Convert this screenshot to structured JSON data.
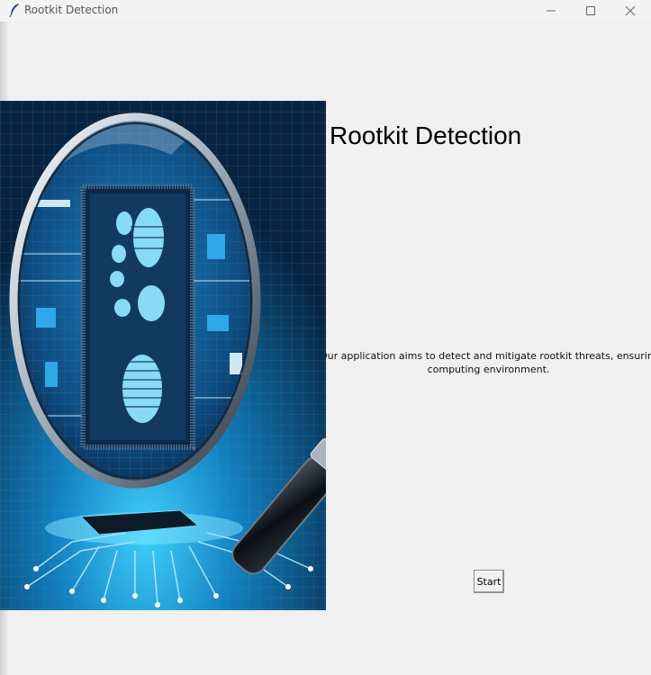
{
  "window": {
    "title": "Rootkit Detection",
    "title_icon": "feather-icon"
  },
  "controls": {
    "minimize_icon": "minimize-icon",
    "maximize_icon": "maximize-icon",
    "close_icon": "close-icon"
  },
  "main": {
    "heading": "Rootkit Detection",
    "description_line1": "Our application aims to detect and mitigate rootkit threats, ensuring a safe",
    "description_line2": "computing environment.",
    "start_label": "Start",
    "image_subject": "magnifying-glass-over-circuit-board-with-footprint"
  },
  "colors": {
    "background": "#f0f0f0",
    "image_dark": "#0b2744",
    "image_accent": "#27b6ee"
  }
}
